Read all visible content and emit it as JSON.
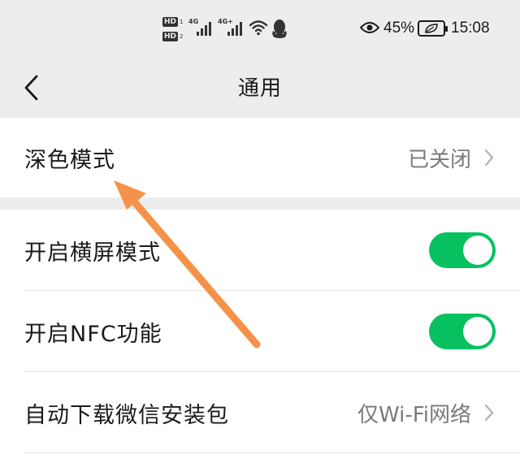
{
  "status_bar": {
    "hd_1": "HD",
    "hd_1_num": "1",
    "hd_2": "HD",
    "hd_2_num": "2",
    "network_1": "4G",
    "network_2": "4G+",
    "battery_percent": "45%",
    "time": "15:08",
    "icons": [
      "eye-comfort-icon",
      "wifi-icon",
      "qq-icon",
      "battery-icon"
    ]
  },
  "header": {
    "title": "通用",
    "back_icon": "chevron-left-icon"
  },
  "settings": {
    "dark_mode": {
      "label": "深色模式",
      "value": "已关闭"
    },
    "items": [
      {
        "label": "开启横屏模式",
        "type": "toggle",
        "on": true
      },
      {
        "label": "开启NFC功能",
        "type": "toggle",
        "on": true
      },
      {
        "label": "自动下载微信安装包",
        "value": "仅Wi-Fi网络",
        "type": "link"
      }
    ]
  },
  "colors": {
    "background": "#ededed",
    "card": "#ffffff",
    "toggle_on": "#07c160",
    "annotation_arrow": "#f5924a",
    "secondary_text": "#7a7a7a"
  }
}
